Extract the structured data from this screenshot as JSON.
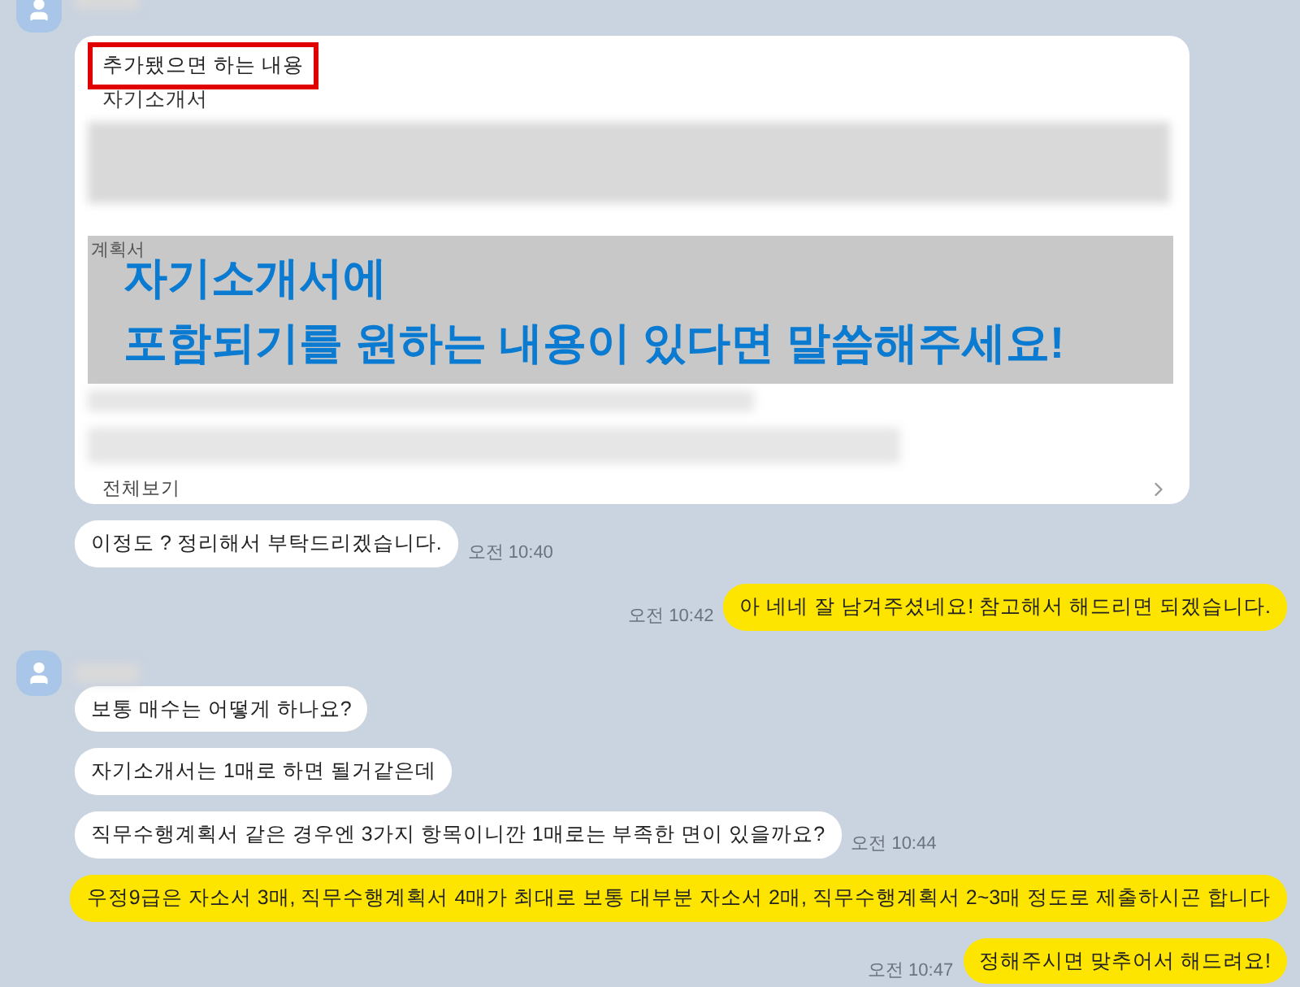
{
  "card": {
    "header": "추가됐으면 하는 내용",
    "header_marked": true,
    "section_1": "자기소개서",
    "section_2": "계획서",
    "overlay": [
      "자기소개서에",
      "포함되기를 원하는 내용이 있다면 말씀해주세요!"
    ],
    "footer": "전체보기"
  },
  "messages": [
    {
      "kind": "received",
      "text": "이정도 ? 정리해서 부탁드리겠습니다.",
      "time": "오전 10:40",
      "avatar": false
    },
    {
      "kind": "sent",
      "text": "아 네네 잘 남겨주셨네요! 참고해서 해드리면 되겠습니다.",
      "time": "오전 10:42"
    },
    {
      "kind": "received",
      "text": "보통 매수는 어떻게 하나요?",
      "avatar": true
    },
    {
      "kind": "received",
      "text": "자기소개서는 1매로 하면 될거같은데",
      "avatar": false
    },
    {
      "kind": "received",
      "text": "직무수행계획서 같은 경우엔 3가지 항목이니깐 1매로는 부족한 면이 있을까요?",
      "time": "오전 10:44",
      "avatar": false
    },
    {
      "kind": "sent",
      "text": "우정9급은 자소서 3매, 직무수행계획서 4매가 최대로 보통 대부분 자소서 2매, 직무수행계획서 2~3매 정도로 제출하시곤 합니다"
    },
    {
      "kind": "sent",
      "text": "정해주시면 맞추어서 해드려요!",
      "time": "오전 10:47"
    }
  ]
}
